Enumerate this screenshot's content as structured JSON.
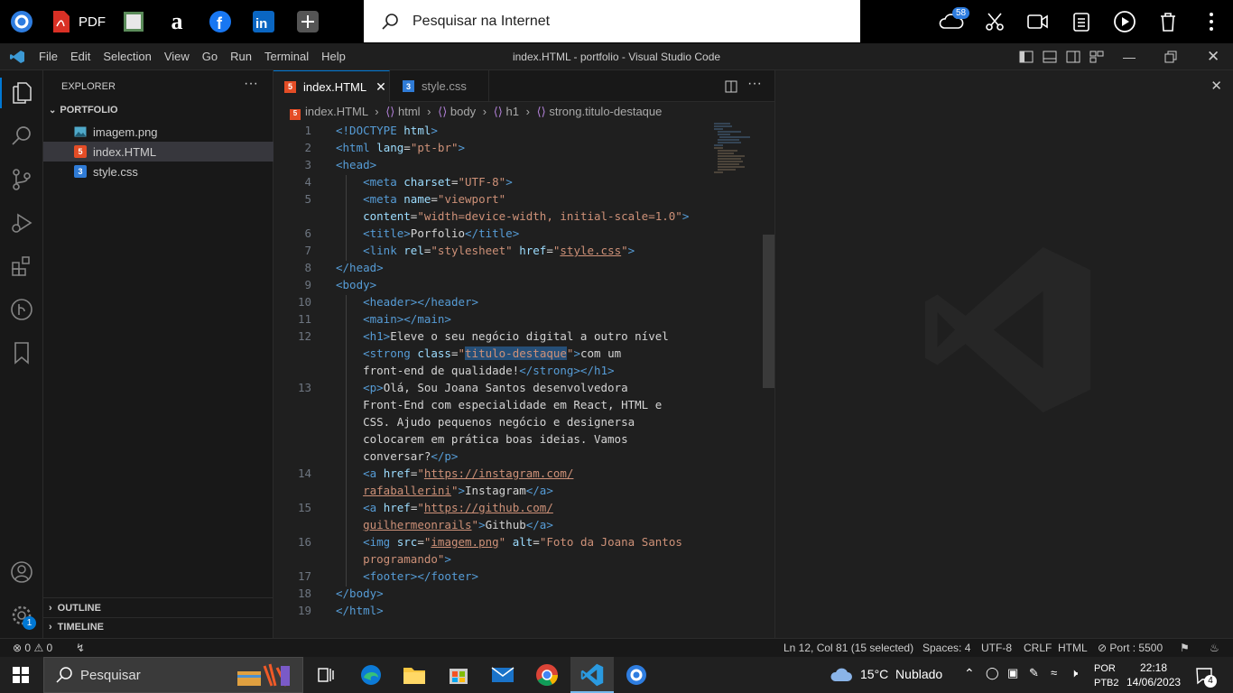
{
  "top_bar": {
    "pdf_label": "PDF",
    "search_placeholder": "Pesquisar na Internet",
    "notification_count": "58"
  },
  "window": {
    "title": "index.HTML - portfolio - Visual Studio Code",
    "menu": [
      "File",
      "Edit",
      "Selection",
      "View",
      "Go",
      "Run",
      "Terminal",
      "Help"
    ]
  },
  "explorer": {
    "title": "EXPLORER",
    "folder": "PORTFOLIO",
    "files": [
      {
        "name": "imagem.png",
        "icon": "image-file-icon"
      },
      {
        "name": "index.HTML",
        "icon": "html-file-icon",
        "selected": true
      },
      {
        "name": "style.css",
        "icon": "css-file-icon"
      }
    ],
    "outline": "OUTLINE",
    "timeline": "TIMELINE"
  },
  "activity_bar": {
    "settings_badge": "1"
  },
  "tabs": [
    {
      "label": "index.HTML",
      "active": true
    },
    {
      "label": "style.css",
      "active": false
    }
  ],
  "breadcrumb": [
    "index.HTML",
    "html",
    "body",
    "h1",
    "strong.titulo-destaque"
  ],
  "code": {
    "line_numbers": [
      "1",
      "2",
      "3",
      "4",
      "5",
      "",
      "6",
      "7",
      "8",
      "9",
      "10",
      "11",
      "12",
      "",
      "",
      "13",
      "",
      "",
      "",
      "",
      "14",
      "",
      "15",
      "",
      "16",
      "",
      "17",
      "18",
      "19"
    ]
  },
  "status_bar": {
    "errors": "0",
    "warnings": "0",
    "position": "Ln 12, Col 81 (15 selected)",
    "spaces": "Spaces: 4",
    "encoding": "UTF-8",
    "eol": "CRLF",
    "language": "HTML",
    "port": "Port : 5500"
  },
  "taskbar": {
    "search_label": "Pesquisar",
    "weather": "15°C  Nublado",
    "lang_line1": "POR",
    "lang_line2": "PTB2",
    "time": "22:18",
    "date": "14/06/2023",
    "notifications": "4"
  }
}
